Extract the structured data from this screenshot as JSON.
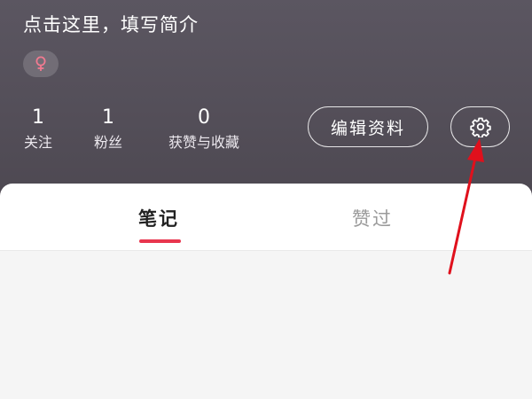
{
  "profile": {
    "bio_placeholder": "点击这里，填写简介",
    "gender_icon": "female-symbol-icon",
    "stats": [
      {
        "value": "1",
        "label": "关注"
      },
      {
        "value": "1",
        "label": "粉丝"
      },
      {
        "value": "0",
        "label": "获赞与收藏"
      }
    ],
    "edit_button_label": "编辑资料",
    "settings_icon": "gear-icon"
  },
  "tabs": {
    "items": [
      {
        "label": "笔记",
        "active": true
      },
      {
        "label": "赞过",
        "active": false
      }
    ]
  },
  "colors": {
    "header_bg": "#57525c",
    "accent": "#e8364e",
    "gender_symbol": "#f07a90",
    "annotation_arrow": "#e0101c"
  }
}
